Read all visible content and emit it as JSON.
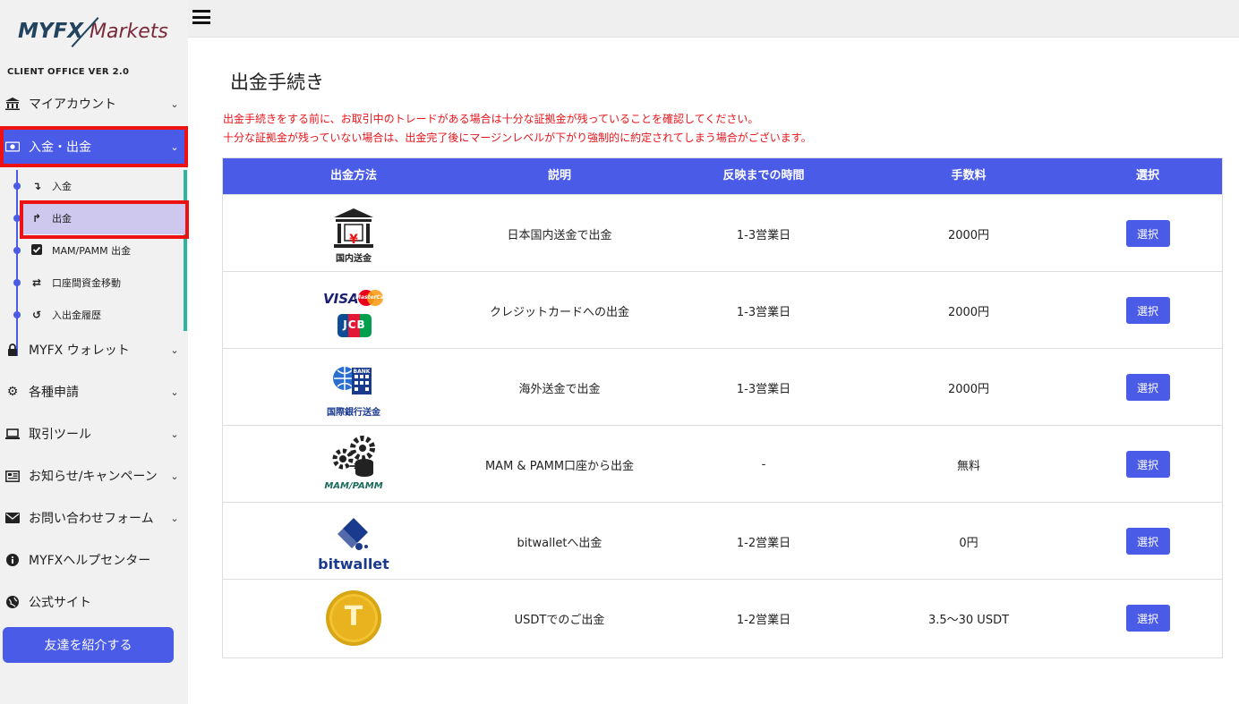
{
  "app": {
    "logo_text_a": "MYFX",
    "logo_text_b": " Markets",
    "version": "CLIENT OFFICE VER 2.0"
  },
  "sidebar": {
    "items": [
      {
        "label": "マイアカウント",
        "icon": "bank-icon"
      },
      {
        "label": "入金・出金",
        "icon": "money-icon"
      },
      {
        "label": "MYFX ウォレット",
        "icon": "lock-icon"
      },
      {
        "label": "各種申請",
        "icon": "cogs-icon"
      },
      {
        "label": "取引ツール",
        "icon": "laptop-icon"
      },
      {
        "label": "お知らせ/キャンペーン",
        "icon": "newspaper-icon"
      },
      {
        "label": "お問い合わせフォーム",
        "icon": "envelope-icon"
      },
      {
        "label": "MYFXヘルプセンター",
        "icon": "info-icon"
      },
      {
        "label": "公式サイト",
        "icon": "globe-icon"
      }
    ],
    "submenu": [
      {
        "label": "入金",
        "icon": "arrow-down-icon"
      },
      {
        "label": "出金",
        "icon": "arrow-up-icon"
      },
      {
        "label": "MAM/PAMM 出金",
        "icon": "checkbox-icon"
      },
      {
        "label": "口座間資金移動",
        "icon": "exchange-icon"
      },
      {
        "label": "入出金履歴",
        "icon": "history-icon"
      }
    ],
    "invite_label": "友達を紹介する"
  },
  "page": {
    "title": "出金手続き",
    "warning_1": "出金手続きをする前に、お取引中のトレードがある場合は十分な証拠金が残っていることを確認してください。",
    "warning_2": "十分な証拠金が残っていない場合は、出金完了後にマージンレベルが下がり強制的に約定されてしまう場合がございます。"
  },
  "table": {
    "headers": [
      "出金方法",
      "説明",
      "反映までの時間",
      "手数料",
      "選択"
    ],
    "rows": [
      {
        "method_caption": "国内送金",
        "description": "日本国内送金で出金",
        "time": "1-3営業日",
        "fee": "2000円",
        "button": "選択"
      },
      {
        "method_caption": "VISA / MasterCard / JCB",
        "description": "クレジットカードへの出金",
        "time": "1-3営業日",
        "fee": "2000円",
        "button": "選択"
      },
      {
        "method_caption": "国際銀行送金",
        "description": "海外送金で出金",
        "time": "1-3営業日",
        "fee": "2000円",
        "button": "選択"
      },
      {
        "method_caption": "MAM/PAMM",
        "description": "MAM & PAMM口座から出金",
        "time": "-",
        "fee": "無料",
        "button": "選択"
      },
      {
        "method_caption": "bitwallet",
        "description": "bitwalletへ出金",
        "time": "1-2営業日",
        "fee": "0円",
        "button": "選択"
      },
      {
        "method_caption": "USDT",
        "description": "USDTでのご出金",
        "time": "1-2営業日",
        "fee": "3.5～30 USDT",
        "button": "選択"
      }
    ]
  },
  "logo_texts": {
    "bank_yen": "¥",
    "visa": "VISA",
    "mastercard": "MasterCard",
    "jcb": "JCB",
    "bank_label": "BANK",
    "bitwallet": "bitwallet",
    "usdt_symbol": "T"
  },
  "colors": {
    "accent": "#4a5be8",
    "warning": "#e8141b",
    "highlight_outline": "#ee1111",
    "submenu_selected": "#cfc8ee",
    "sidebar_bg": "#f1f1f1"
  }
}
